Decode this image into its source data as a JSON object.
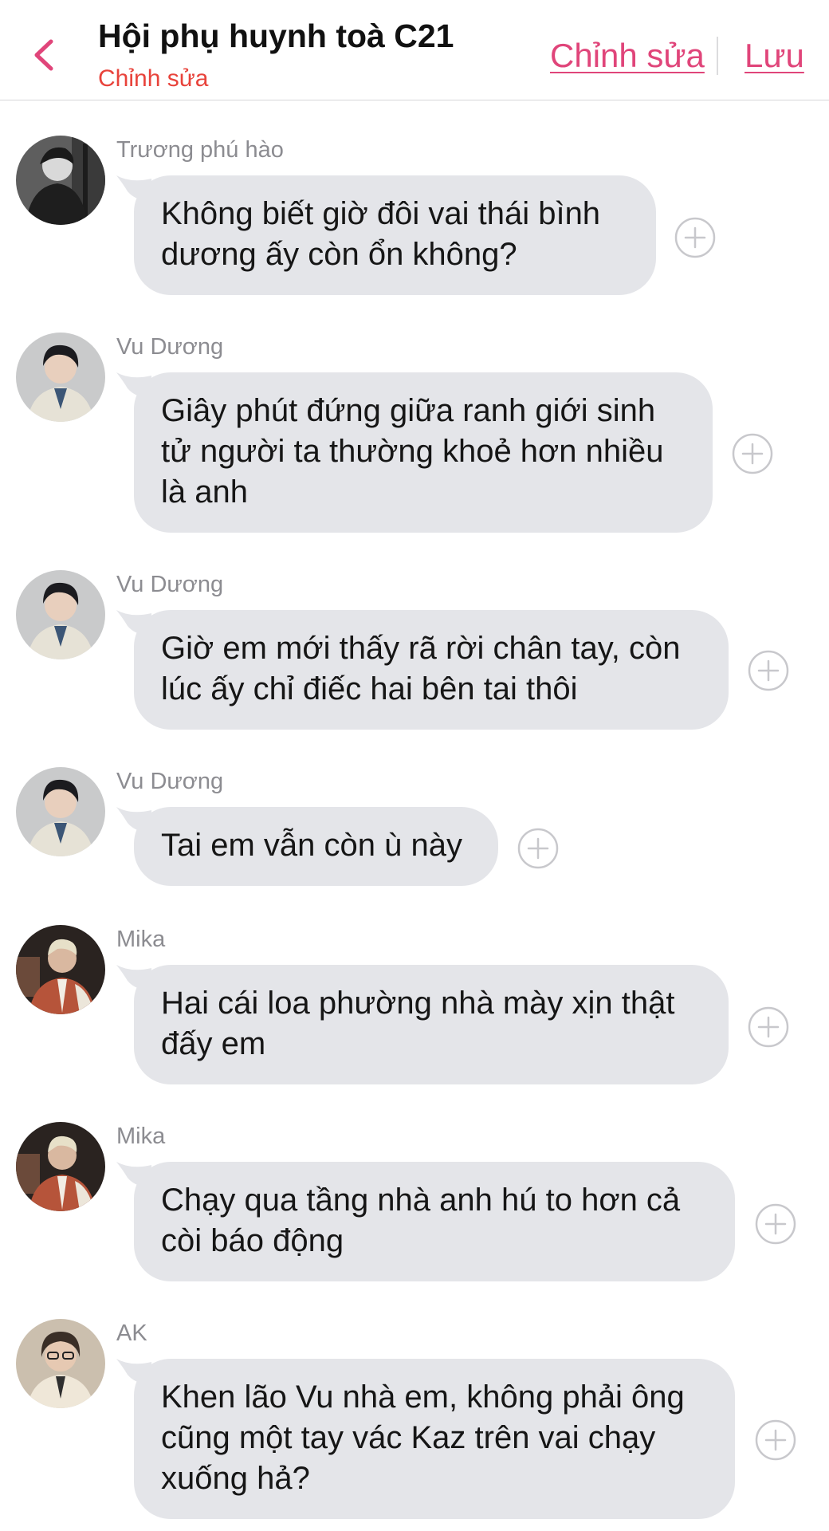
{
  "header": {
    "title": "Hội phụ huynh toà C21",
    "subtitle": "Chỉnh sửa",
    "edit_label": "Chỉnh sửa",
    "save_label": "Lưu",
    "back_icon": "chevron-left-icon",
    "accent_color": "#e0457a",
    "subtitle_color": "#e8433b"
  },
  "messages": [
    {
      "sender": "Trương phú hào",
      "text": "Không biết giờ đôi vai thái bình dương ấy còn ổn không?"
    },
    {
      "sender": "Vu Dương",
      "text": "Giây phút đứng giữa ranh giới sinh tử người ta thường khoẻ hơn nhiều là anh"
    },
    {
      "sender": "Vu Dương",
      "text": "Giờ em mới thấy rã rời chân tay, còn lúc ấy chỉ điếc hai bên tai thôi"
    },
    {
      "sender": "Vu Dương",
      "text": "Tai em vẫn còn ù này"
    },
    {
      "sender": "Mika",
      "text": "Hai cái loa phường nhà mày xịn thật đấy em"
    },
    {
      "sender": "Mika",
      "text": "Chạy qua tầng nhà anh hú to hơn cả còi báo động"
    },
    {
      "sender": "AK",
      "text": "Khen lão Vu nhà em, không phải ông cũng một tay vác Kaz trên vai chạy xuống hả?"
    }
  ],
  "colors": {
    "bubble": "#e4e5e9",
    "sender_text": "#8c8c91",
    "message_text": "#161616"
  },
  "icons": {
    "reaction": "plus-circle-icon",
    "avatar": "avatar"
  }
}
